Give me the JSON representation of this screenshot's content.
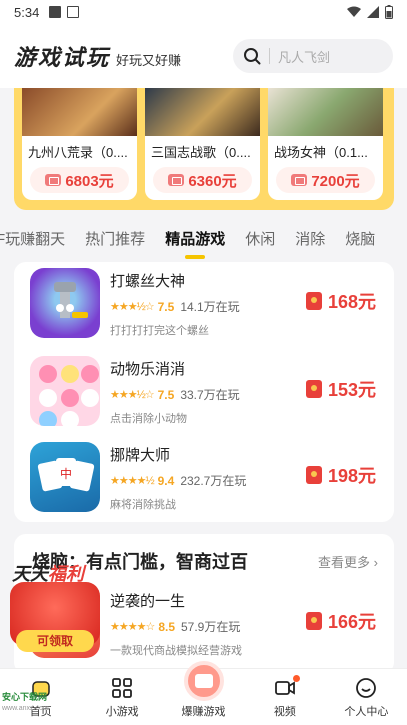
{
  "status_bar": {
    "time": "5:34"
  },
  "header": {
    "title": "游戏试玩",
    "subtitle": "好玩又好赚",
    "search_placeholder": "凡人飞剑"
  },
  "featured": [
    {
      "name": "九州八荒录（0....",
      "reward": "6803元"
    },
    {
      "name": "三国志战歌（0....",
      "reward": "6360元"
    },
    {
      "name": "战场女神（0.1...",
      "reward": "7200元"
    }
  ],
  "tabs": [
    {
      "label": "F玩赚翻天",
      "active": false
    },
    {
      "label": "热门推荐",
      "active": false
    },
    {
      "label": "精品游戏",
      "active": true
    },
    {
      "label": "休闲",
      "active": false
    },
    {
      "label": "消除",
      "active": false
    },
    {
      "label": "烧脑",
      "active": false
    }
  ],
  "games": [
    {
      "name": "打螺丝大神",
      "rating": "7.5",
      "players": "14.1万在玩",
      "desc": "打打打打完这个螺丝",
      "reward": "168元",
      "stars": "★★★½☆",
      "icon": "screw-game-icon"
    },
    {
      "name": "动物乐消消",
      "rating": "7.5",
      "players": "33.7万在玩",
      "desc": "点击消除小动物",
      "reward": "153元",
      "stars": "★★★½☆",
      "icon": "animal-match-icon"
    },
    {
      "name": "挪牌大师",
      "rating": "9.4",
      "players": "232.7万在玩",
      "desc": "麻将消除挑战",
      "reward": "198元",
      "stars": "★★★★½",
      "icon": "mahjong-icon"
    }
  ],
  "puzzle_section": {
    "title": "烧脑：有点门槛，智商过百",
    "see_more": "查看更多 ›",
    "game": {
      "name": "逆袭的一生",
      "rating": "8.5",
      "players": "57.9万在玩",
      "desc": "一款现代商战模拟经营游戏",
      "reward": "166元",
      "stars": "★★★★☆"
    }
  },
  "promo": {
    "title_a": "天天",
    "title_b": "福利",
    "button": "可领取"
  },
  "bottom_nav": [
    {
      "label": "首页"
    },
    {
      "label": "小游戏"
    },
    {
      "label": "爆赚游戏"
    },
    {
      "label": "视频"
    },
    {
      "label": "个人中心"
    }
  ],
  "watermark": {
    "line1": "安心下载网",
    "line2": "www.anxz.com"
  },
  "colors": {
    "accent_yellow": "#ffd968",
    "reward_red": "#e8403a",
    "star": "#f5a623"
  }
}
